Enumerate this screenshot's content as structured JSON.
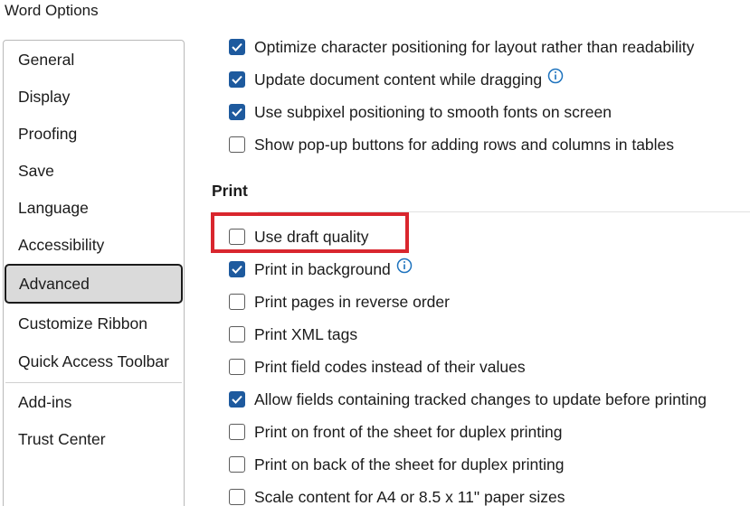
{
  "window": {
    "title": "Word Options"
  },
  "sidebar": {
    "items": [
      {
        "label": "General"
      },
      {
        "label": "Display"
      },
      {
        "label": "Proofing"
      },
      {
        "label": "Save"
      },
      {
        "label": "Language"
      },
      {
        "label": "Accessibility"
      },
      {
        "label": "Advanced",
        "selected": true
      },
      {
        "label": "Customize Ribbon"
      },
      {
        "label": "Quick Access Toolbar"
      },
      {
        "label": "Add-ins"
      },
      {
        "label": "Trust Center"
      }
    ]
  },
  "display_options": [
    {
      "label": "Optimize character positioning for layout rather than readability",
      "checked": true
    },
    {
      "label": "Update document content while dragging",
      "checked": true,
      "info": true
    },
    {
      "label": "Use subpixel positioning to smooth fonts on screen",
      "checked": true
    },
    {
      "label": "Show pop-up buttons for adding rows and columns in tables",
      "checked": false
    }
  ],
  "print_section": {
    "title": "Print",
    "options": [
      {
        "label": "Use draft quality",
        "checked": false,
        "highlighted": true
      },
      {
        "label": "Print in background",
        "checked": true,
        "info": true
      },
      {
        "label": "Print pages in reverse order",
        "checked": false
      },
      {
        "label": "Print XML tags",
        "checked": false
      },
      {
        "label": "Print field codes instead of their values",
        "checked": false
      },
      {
        "label": "Allow fields containing tracked changes to update before printing",
        "checked": true
      },
      {
        "label": "Print on front of the sheet for duplex printing",
        "checked": false
      },
      {
        "label": "Print on back of the sheet for duplex printing",
        "checked": false
      },
      {
        "label": "Scale content for A4 or 8.5 x 11\" paper sizes",
        "checked": false
      }
    ]
  },
  "icons": {
    "info": "info-circle-icon",
    "checkmark": "checkmark-icon"
  },
  "colors": {
    "checkbox_checked": "#1e5a9e",
    "highlight": "#d9262e",
    "info_icon": "#1e73be",
    "selected_nav_bg": "#dadada"
  }
}
